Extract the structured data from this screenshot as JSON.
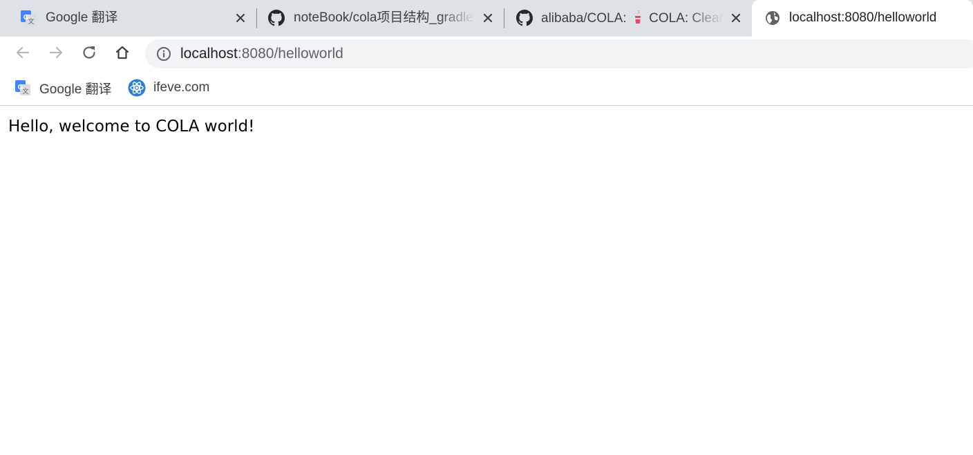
{
  "tabs": [
    {
      "title": "Google 翻译",
      "icon": "google-translate-icon",
      "active": false
    },
    {
      "title": "noteBook/cola项目结构_gradle",
      "icon": "github-icon",
      "active": false
    },
    {
      "title_prefix": "alibaba/COLA: ",
      "title_emoji": "cup-with-straw-icon",
      "title_suffix": " COLA: Clean",
      "icon": "github-icon",
      "active": false
    },
    {
      "title": "localhost:8080/helloworld",
      "icon": "globe-icon",
      "active": true
    }
  ],
  "toolbar": {
    "back_icon": "back-arrow-icon",
    "forward_icon": "forward-arrow-icon",
    "reload_icon": "reload-icon",
    "home_icon": "home-icon"
  },
  "omnibox": {
    "security_icon": "info-icon",
    "host": "localhost",
    "rest": ":8080/helloworld"
  },
  "bookmarks": [
    {
      "label": "Google 翻译",
      "icon": "google-translate-icon"
    },
    {
      "label": "ifeve.com",
      "icon": "atom-icon"
    }
  ],
  "page": {
    "message": "Hello, welcome to COLA world!"
  },
  "colors": {
    "tabstrip_bg": "#dee1e6",
    "omnibox_bg": "#f1f3f4",
    "google_blue": "#4285f4",
    "ifeve_blue": "#2a7ed3"
  }
}
